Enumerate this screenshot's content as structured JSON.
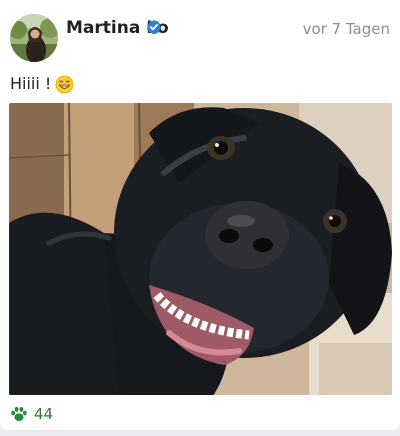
{
  "post": {
    "author": "Martina Lo",
    "time": "vor 7 Tagen",
    "text": "Hiiii !",
    "reactions_count": "44"
  },
  "colors": {
    "verified": "#2f7fd6",
    "paw": "#2a8a38",
    "timestamp": "#8a8f96"
  },
  "icons": [
    "verified-badge-icon",
    "grinning-emoji-icon",
    "paw-icon"
  ]
}
